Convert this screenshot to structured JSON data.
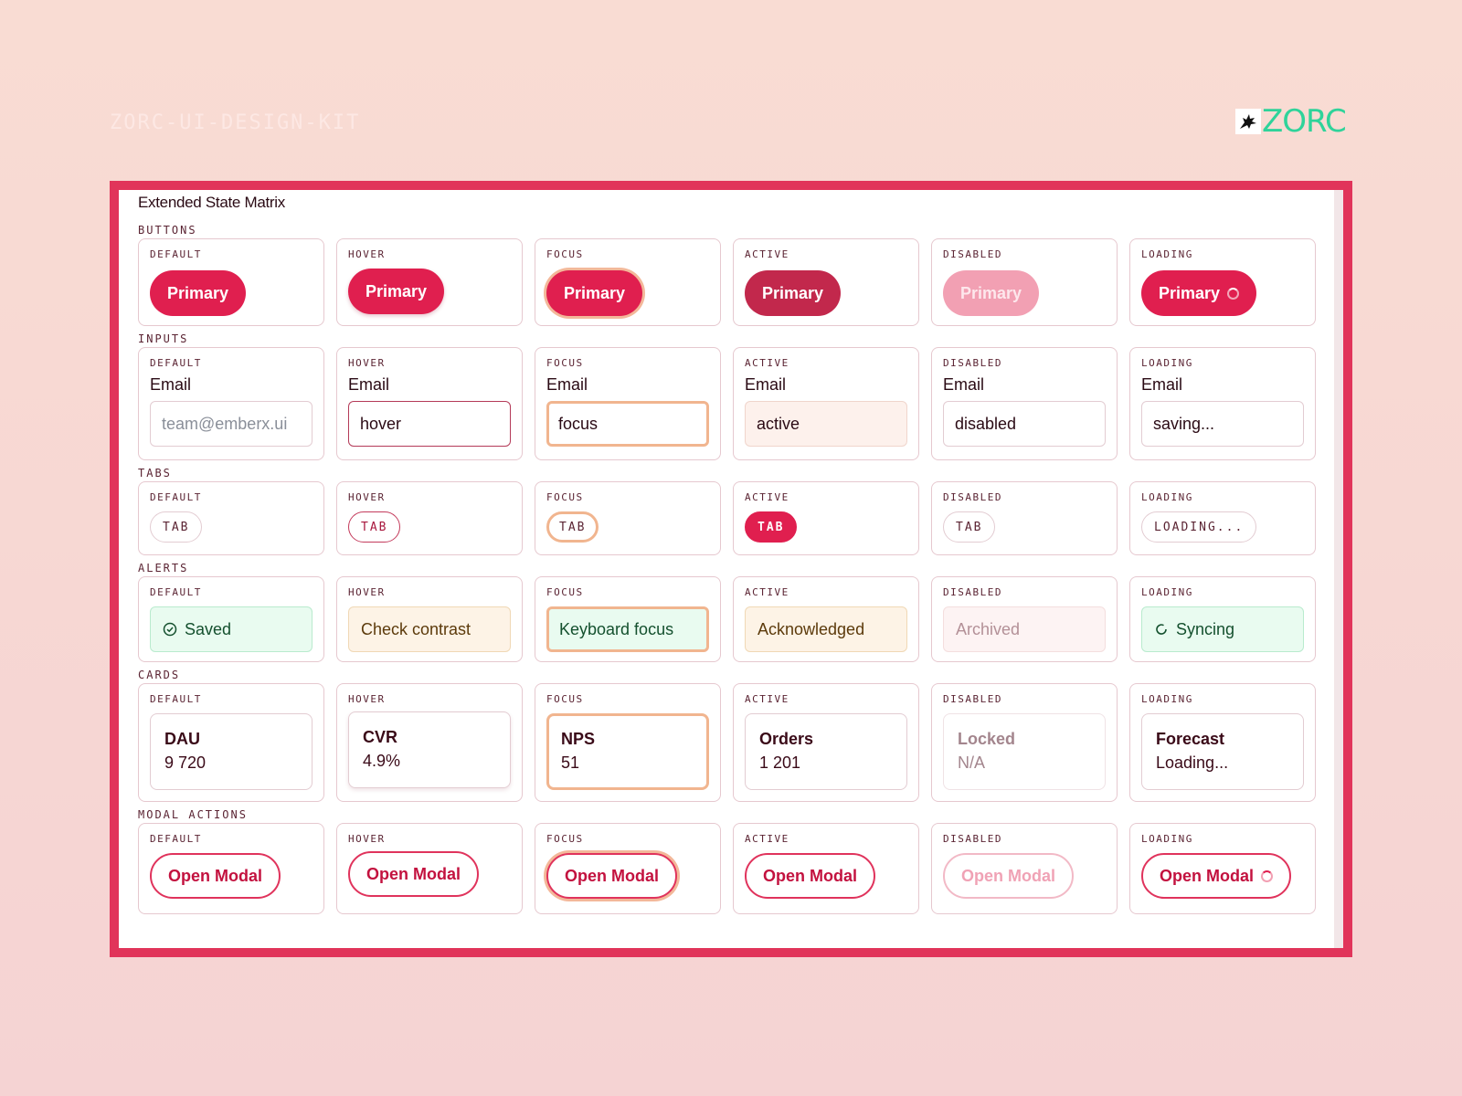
{
  "header": {
    "kit_title": "ZORC-UI-DESIGN-KIT",
    "logo_text": "ZORC"
  },
  "colors": {
    "accent": "#e01f4f",
    "frame": "#e1345a",
    "logo": "#2fd39a"
  },
  "matrix": {
    "title": "Extended State Matrix",
    "states": [
      "DEFAULT",
      "HOVER",
      "FOCUS",
      "ACTIVE",
      "DISABLED",
      "LOADING"
    ],
    "buttons": {
      "label": "BUTTONS",
      "text": "Primary"
    },
    "inputs": {
      "label": "INPUTS",
      "field_label": "Email",
      "placeholder": "team@emberx.ui",
      "values": [
        "hover",
        "focus",
        "active",
        "disabled",
        "saving..."
      ]
    },
    "tabs": {
      "label": "TABS",
      "text": "TAB",
      "loading_text": "LOADING..."
    },
    "alerts": {
      "label": "ALERTS",
      "items": [
        "Saved",
        "Check contrast",
        "Keyboard focus",
        "Acknowledged",
        "Archived",
        "Syncing"
      ]
    },
    "cards": {
      "label": "CARDS",
      "items": [
        {
          "title": "DAU",
          "value": "9 720"
        },
        {
          "title": "CVR",
          "value": "4.9%"
        },
        {
          "title": "NPS",
          "value": "51"
        },
        {
          "title": "Orders",
          "value": "1 201"
        },
        {
          "title": "Locked",
          "value": "N/A"
        },
        {
          "title": "Forecast",
          "value": "Loading..."
        }
      ]
    },
    "modal_actions": {
      "label": "MODAL ACTIONS",
      "text": "Open Modal"
    }
  }
}
